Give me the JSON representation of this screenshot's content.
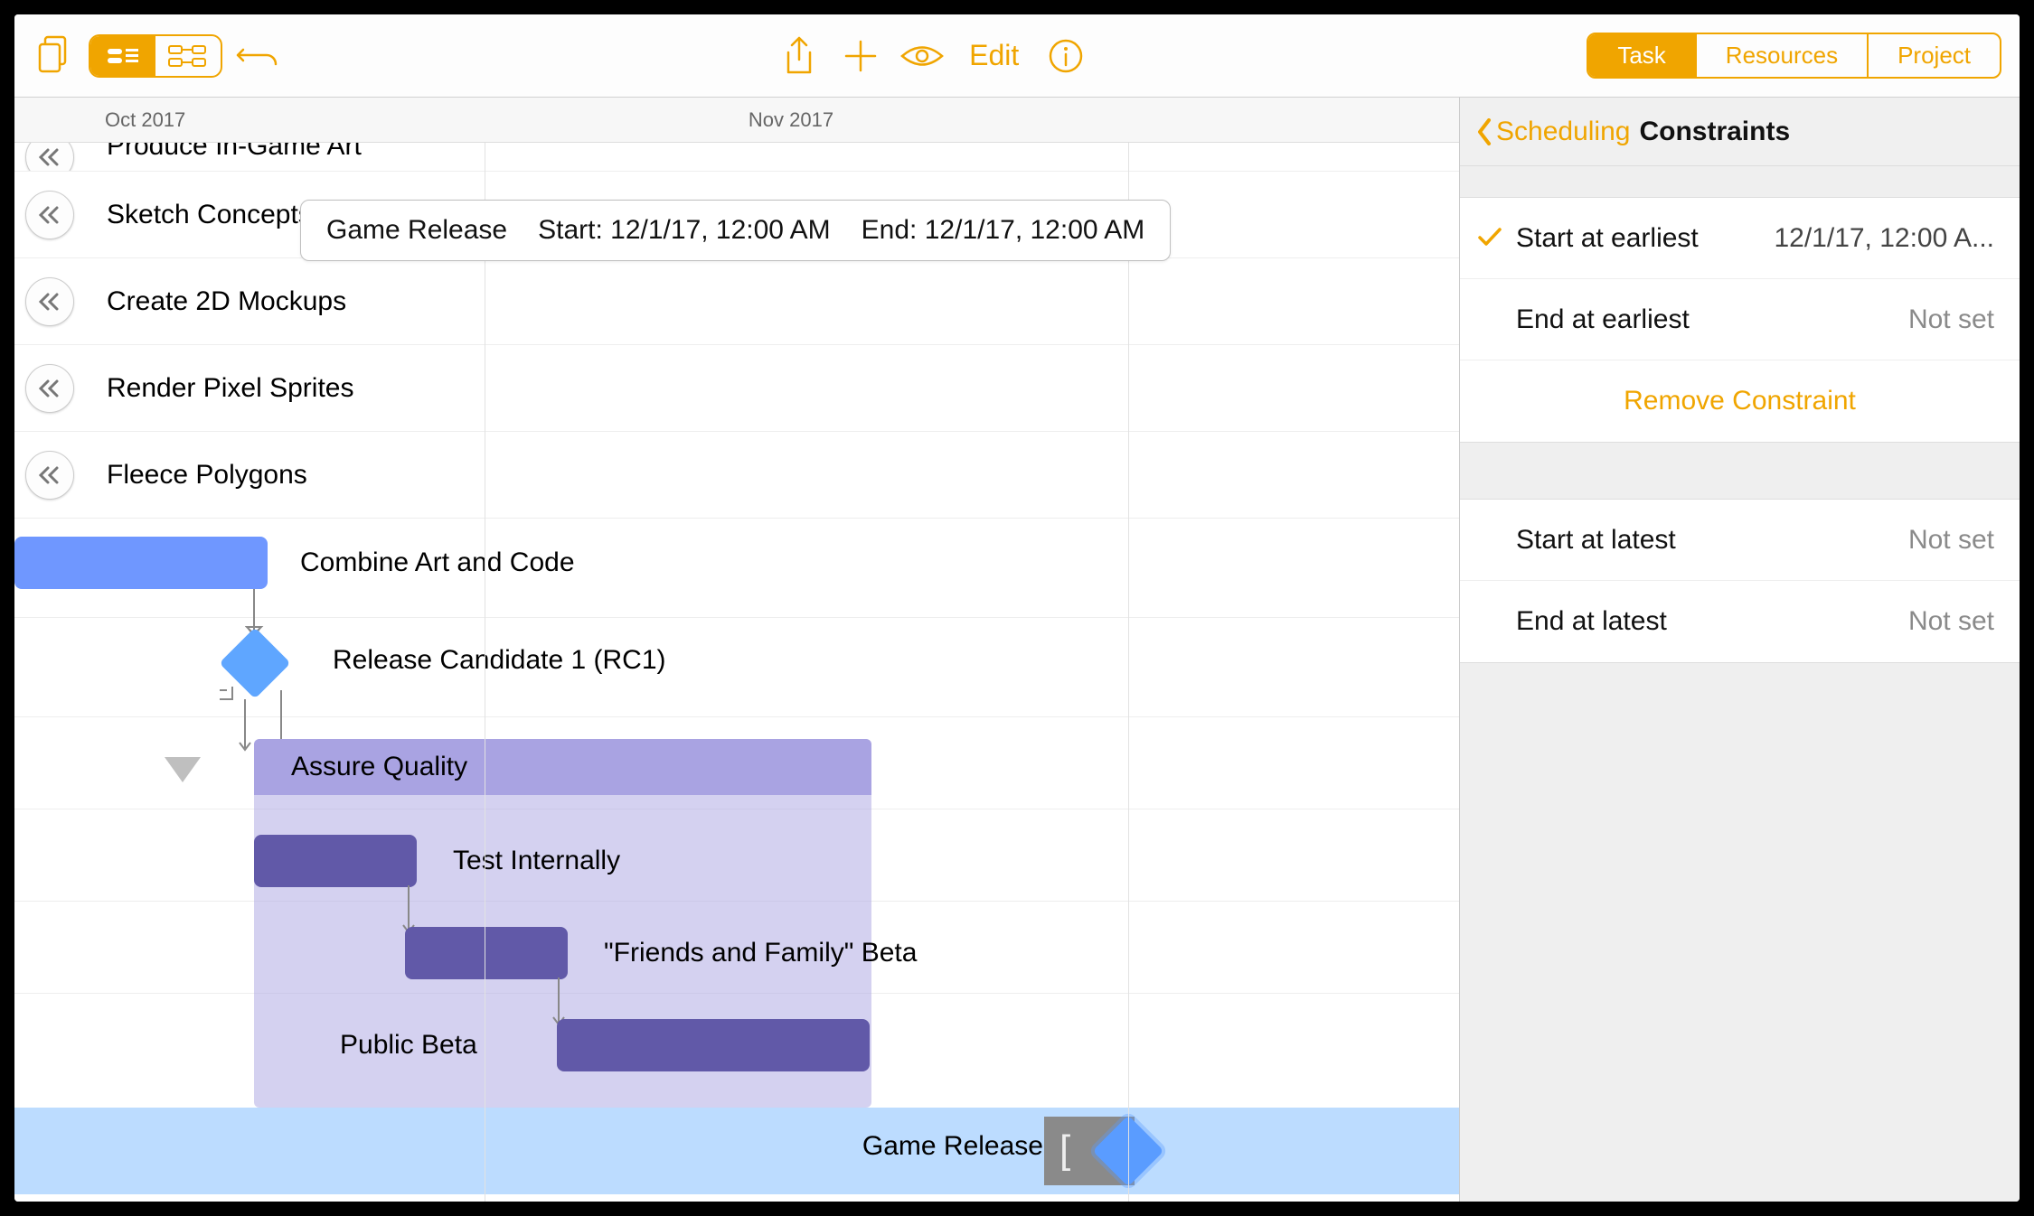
{
  "toolbar": {
    "edit_label": "Edit"
  },
  "timeline": {
    "month_left": "Oct 2017",
    "month_right": "Nov 2017"
  },
  "tooltip": {
    "name": "Game Release",
    "start_prefix": "Start:",
    "start_value": "12/1/17, 12:00 AM",
    "end_prefix": "End:",
    "end_value": "12/1/17, 12:00 AM"
  },
  "tasks": {
    "t0": "Produce In-Game Art",
    "t1": "Sketch Concepts (Fresh)",
    "t2": "Create 2D Mockups",
    "t3": "Render Pixel Sprites",
    "t4": "Fleece Polygons",
    "t5": "Combine Art and Code",
    "t6": "Release Candidate 1 (RC1)",
    "t7": "Assure Quality",
    "t8": "Test Internally",
    "t9": "\"Friends and Family\" Beta",
    "t10": "Public Beta",
    "t11": "Game Release"
  },
  "sidebar": {
    "tabs": {
      "task": "Task",
      "resources": "Resources",
      "project": "Project"
    },
    "breadcrumb_back": "Scheduling",
    "breadcrumb_current": "Constraints",
    "start_earliest_label": "Start at earliest",
    "start_earliest_value": "12/1/17, 12:00 A...",
    "end_earliest_label": "End at earliest",
    "end_earliest_value": "Not set",
    "remove_label": "Remove Constraint",
    "start_latest_label": "Start at latest",
    "start_latest_value": "Not set",
    "end_latest_label": "End at latest",
    "end_latest_value": "Not set"
  }
}
